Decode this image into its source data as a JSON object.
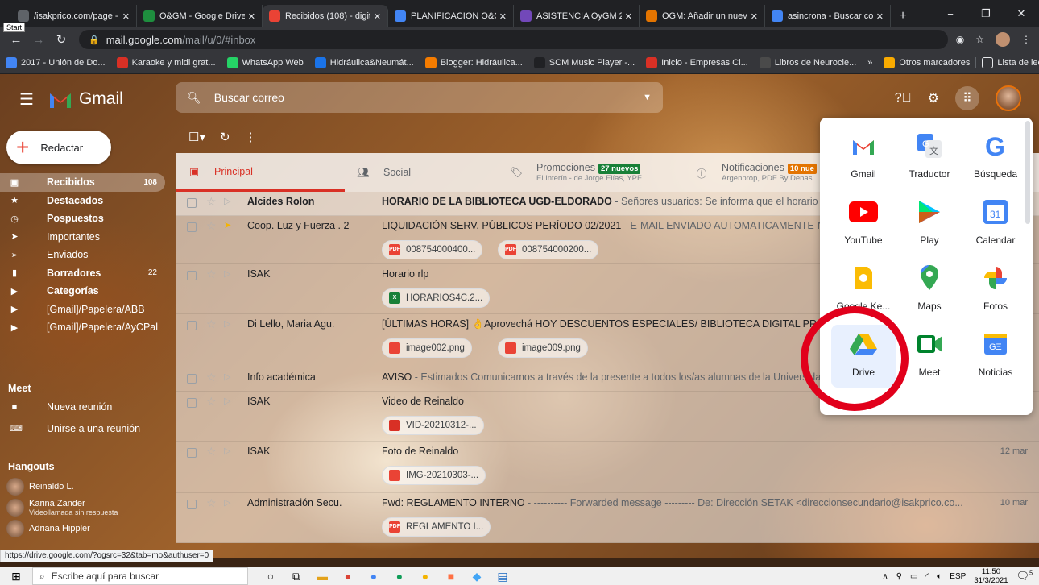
{
  "browser": {
    "tabs": [
      {
        "label": "/isakprico.com/page - ",
        "color": "#5f6368",
        "active": false
      },
      {
        "label": "O&GM - Google Drive",
        "color": "#1e8e3e",
        "active": false
      },
      {
        "label": "Recibidos (108) - digitr",
        "color": "#ea4335",
        "active": true
      },
      {
        "label": "PLANIFICACION O&GM",
        "color": "#4285f4",
        "active": false
      },
      {
        "label": "ASISTENCIA OyGM 22-",
        "color": "#7248b9",
        "active": false
      },
      {
        "label": "OGM: Añadir un nuevo",
        "color": "#e37400",
        "active": false
      },
      {
        "label": "asincrona - Buscar con",
        "color": "#4285f4",
        "active": false
      }
    ],
    "start_tip": "Start",
    "address_host": "mail.google.com",
    "address_path": "/mail/u/0/#inbox",
    "bookmarks": [
      "2017 - Unión de Do...",
      "Karaoke y midi grat...",
      "WhatsApp Web",
      "Hidráulica&Neumát...",
      "Blogger: Hidráulica...",
      "SCM Music Player -...",
      "Inicio - Empresas Cl...",
      "Libros de Neurocie..."
    ],
    "bookmarks_more": "»",
    "bookmarks_right": [
      "Otros marcadores",
      "Lista de lectura"
    ]
  },
  "gmail": {
    "brand": "Gmail",
    "search_placeholder": "Buscar correo",
    "compose": "Redactar",
    "sidebar": [
      {
        "label": "Recibidos",
        "count": "108",
        "icon": "inbox-icon",
        "active": true
      },
      {
        "label": "Destacados",
        "count": "",
        "icon": "star-icon"
      },
      {
        "label": "Pospuestos",
        "count": "",
        "icon": "clock-icon"
      },
      {
        "label": "Importantes",
        "count": "",
        "icon": "important-icon"
      },
      {
        "label": "Enviados",
        "count": "",
        "icon": "send-icon"
      },
      {
        "label": "Borradores",
        "count": "22",
        "icon": "draft-icon"
      },
      {
        "label": "Categorías",
        "count": "",
        "icon": "label-icon"
      },
      {
        "label": "[Gmail]/Papelera/ABB",
        "count": "",
        "icon": "label-icon"
      },
      {
        "label": "[Gmail]/Papelera/AyCPal",
        "count": "",
        "icon": "label-icon"
      }
    ],
    "meet_title": "Meet",
    "meet_items": [
      "Nueva reunión",
      "Unirse a una reunión"
    ],
    "hangouts_title": "Hangouts",
    "hangouts": [
      {
        "name": "Reinaldo L.",
        "status": ""
      },
      {
        "name": "Karina Zander",
        "status": "Videollamada sin respuesta"
      },
      {
        "name": "Adriana Hippler",
        "status": ""
      }
    ],
    "category_tabs": [
      {
        "label": "Principal",
        "sub": "",
        "badge": "",
        "selected": true
      },
      {
        "label": "Social",
        "sub": "",
        "badge": "",
        "selected": false
      },
      {
        "label": "Promociones",
        "sub": "El Interín - de Jorge Elías, YPF ...",
        "badge": "27 nuevos",
        "badge_color": "#188038",
        "selected": false
      },
      {
        "label": "Notificaciones",
        "sub": "Argenprop, PDF By Denas",
        "badge": "10 nue",
        "badge_color": "#e37400",
        "selected": false
      }
    ],
    "emails": [
      {
        "sender": "Alcides Rolon",
        "subject": "HORARIO DE LA BIBLIOTECA UGD-ELDORADO",
        "snippet": " - Señores usuarios: Se informa que el horario de atenc",
        "date": "",
        "unread": true,
        "important": false,
        "attachments": []
      },
      {
        "sender": "Coop. Luz y Fuerza . 2",
        "subject": "LIQUIDACIÓN SERV. PÚBLICOS PERÍODO 02/2021",
        "snippet": " - E-MAIL ENVIADO AUTOMATICAMENTE-NO RESPO",
        "date": "",
        "unread": false,
        "important": true,
        "attachments": [
          {
            "name": "008754000400...",
            "type": "PDF"
          },
          {
            "name": "008754000200...",
            "type": "PDF"
          }
        ]
      },
      {
        "sender": "ISAK",
        "subject": "Horario rlp",
        "snippet": "",
        "date": "",
        "unread": false,
        "important": false,
        "attachments": [
          {
            "name": "HORARIOS4C.2...",
            "type": "X"
          }
        ]
      },
      {
        "sender": "Di Lello, Maria Agu.",
        "subject": "[ÚLTIMAS HORAS] 👌Aprovechá HOY DESCUENTOS ESPECIALES/ BIBLIOTECA DIGITAL PROFESIONA",
        "snippet": "",
        "date": "",
        "unread": false,
        "important": false,
        "attachments": [
          {
            "name": "image002.png",
            "type": "IMG"
          },
          {
            "name": "image009.png",
            "type": "IMG"
          }
        ]
      },
      {
        "sender": "Info académica",
        "subject": "AVISO",
        "snippet": " - Estimados Comunicamos a través de la presente a todos los/as alumnas de la Universidad C",
        "date": "",
        "unread": false,
        "important": false,
        "attachments": []
      },
      {
        "sender": "ISAK",
        "subject": "Video de Reinaldo",
        "snippet": "",
        "date": "12 mar",
        "unread": false,
        "important": false,
        "attachments": [
          {
            "name": "VID-20210312-...",
            "type": "VID"
          }
        ]
      },
      {
        "sender": "ISAK",
        "subject": "Foto de Reinaldo",
        "snippet": "",
        "date": "12 mar",
        "unread": false,
        "important": false,
        "attachments": [
          {
            "name": "IMG-20210303-...",
            "type": "IMG"
          }
        ]
      },
      {
        "sender": "Administración Secu.",
        "subject": "Fwd: REGLAMENTO INTERNO",
        "snippet": " - ---------- Forwarded message --------- De: Dirección SETAK <direccionsecundario@isakprico.co...",
        "date": "10 mar",
        "unread": false,
        "important": false,
        "attachments": [
          {
            "name": "REGLAMENTO I...",
            "type": "PDF"
          }
        ]
      }
    ],
    "apps": [
      {
        "label": "Gmail",
        "icon": "gmail-icon"
      },
      {
        "label": "Traductor",
        "icon": "translate-icon"
      },
      {
        "label": "Búsqueda",
        "icon": "google-search-icon"
      },
      {
        "label": "YouTube",
        "icon": "youtube-icon"
      },
      {
        "label": "Play",
        "icon": "play-icon"
      },
      {
        "label": "Calendar",
        "icon": "calendar-icon"
      },
      {
        "label": "Google Ke...",
        "icon": "keep-icon"
      },
      {
        "label": "Maps",
        "icon": "maps-icon"
      },
      {
        "label": "Fotos",
        "icon": "photos-icon"
      },
      {
        "label": "Drive",
        "icon": "drive-icon"
      },
      {
        "label": "Meet",
        "icon": "meet-icon"
      },
      {
        "label": "Noticias",
        "icon": "news-icon"
      }
    ],
    "calendar_day": "31"
  },
  "status_url": "https://drive.google.com/?ogsrc=32&tab=mo&authuser=0",
  "taskbar": {
    "search": "Escribe aquí para buscar",
    "lang": "ESP",
    "time": "11:50",
    "date": "31/3/2021",
    "notif": "5"
  }
}
